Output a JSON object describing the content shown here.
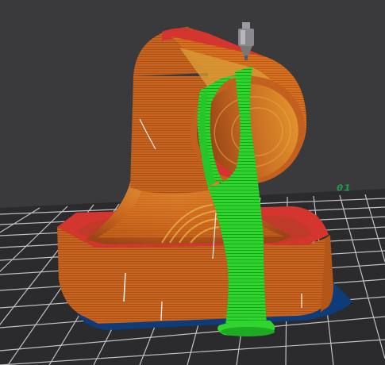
{
  "viewport": {
    "plate_number": "01",
    "background_color": "#3a3a3c",
    "grid_color": "#d2d2d4",
    "plate_color": "#2b2b2d",
    "model": {
      "body_color": "#c8641e",
      "top_surface_color": "#d4352e",
      "support_color": "#22c12a",
      "brim_color": "#0e3b79"
    },
    "icons": {
      "nozzle": "print-nozzle-icon"
    }
  }
}
